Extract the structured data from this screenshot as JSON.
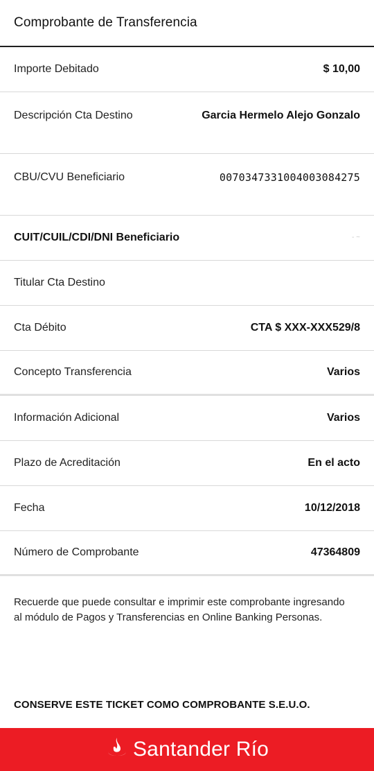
{
  "header": {
    "title": "Comprobante de Transferencia"
  },
  "rows": [
    {
      "label": "Importe Debitado",
      "value": "$ 10,00"
    },
    {
      "label": "Descripción Cta Destino",
      "value": "Garcia Hermelo Alejo Gonzalo"
    },
    {
      "label": "CBU/CVU Beneficiario",
      "value": "0070347331004003084275"
    },
    {
      "label": "CUIT/CUIL/CDI/DNI Beneficiario",
      "value": "- ~"
    },
    {
      "label": "Titular Cta Destino",
      "value": ""
    },
    {
      "label": "Cta Débito",
      "value": "CTA $ XXX-XXX529/8"
    },
    {
      "label": "Concepto Transferencia",
      "value": "Varios"
    },
    {
      "label": "Información Adicional",
      "value": "Varios"
    },
    {
      "label": "Plazo de Acreditación",
      "value": "En el acto"
    },
    {
      "label": "Fecha",
      "value": "10/12/2018"
    },
    {
      "label": "Número de Comprobante",
      "value": "47364809"
    }
  ],
  "note": "Recuerde que puede consultar e imprimir este comprobante ingresando al módulo de Pagos y Transferencias en Online Banking Personas.",
  "conserve": "CONSERVE ESTE TICKET COMO COMPROBANTE S.E.U.O.",
  "footer": {
    "brand": "Santander Río",
    "logo_icon": "flame-logo-icon",
    "background": "#ec1c24"
  }
}
